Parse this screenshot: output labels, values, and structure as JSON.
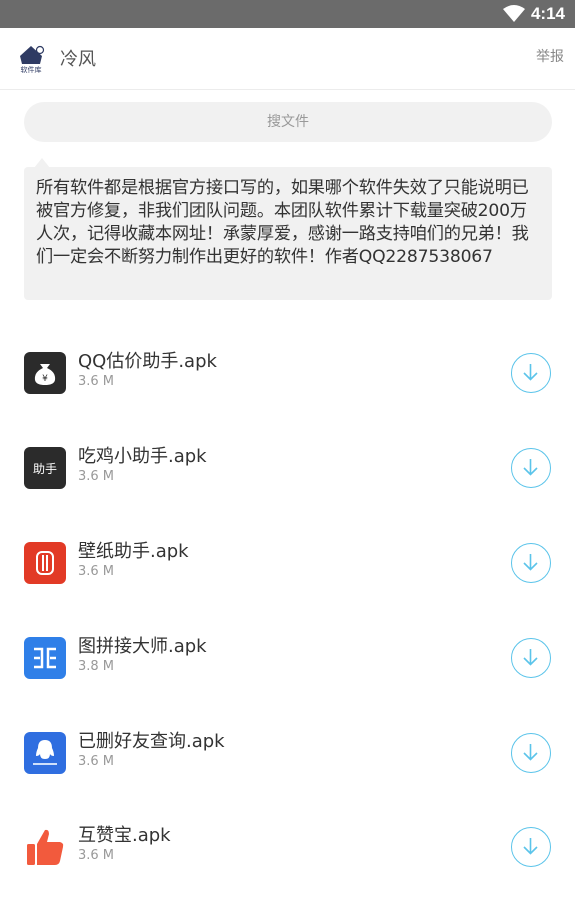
{
  "status_bar": {
    "time": "4:14"
  },
  "header": {
    "logo_text": "软件库",
    "title": "冷风",
    "report": "举报"
  },
  "search": {
    "placeholder": "搜文件"
  },
  "notice": "所有软件都是根据官方接口写的，如果哪个软件失效了只能说明已被官方修复，非我们团队问题。本团队软件累计下载量突破200万人次，记得收藏本网址！承蒙厚爱，感谢一路支持咱们的兄弟！我们一定会不断努力制作出更好的软件！作者QQ2287538067",
  "files": [
    {
      "name": "QQ估价助手.apk",
      "size": "3.6 M",
      "icon": "money-bag-icon",
      "icon_color": "#2b2b2b"
    },
    {
      "name": "吃鸡小助手.apk",
      "size": "3.6 M",
      "icon": "assistant-icon",
      "icon_color": "#2b2b2b",
      "icon_text": "助手"
    },
    {
      "name": "壁纸助手.apk",
      "size": "3.6 M",
      "icon": "wallpaper-icon",
      "icon_color": "#e23a26"
    },
    {
      "name": "图拼接大师.apk",
      "size": "3.8 M",
      "icon": "stitch-icon",
      "icon_color": "#2f7fe8"
    },
    {
      "name": "已删好友查询.apk",
      "size": "3.6 M",
      "icon": "qq-penguin-icon",
      "icon_color": "#2f6ee0"
    },
    {
      "name": "互赞宝.apk",
      "size": "3.6 M",
      "icon": "thumbs-up-icon",
      "icon_color": "#f25a3d"
    }
  ],
  "colors": {
    "accent": "#5bc4ea",
    "status_bar": "#6b6b6b",
    "panel": "#f1f1f1"
  }
}
